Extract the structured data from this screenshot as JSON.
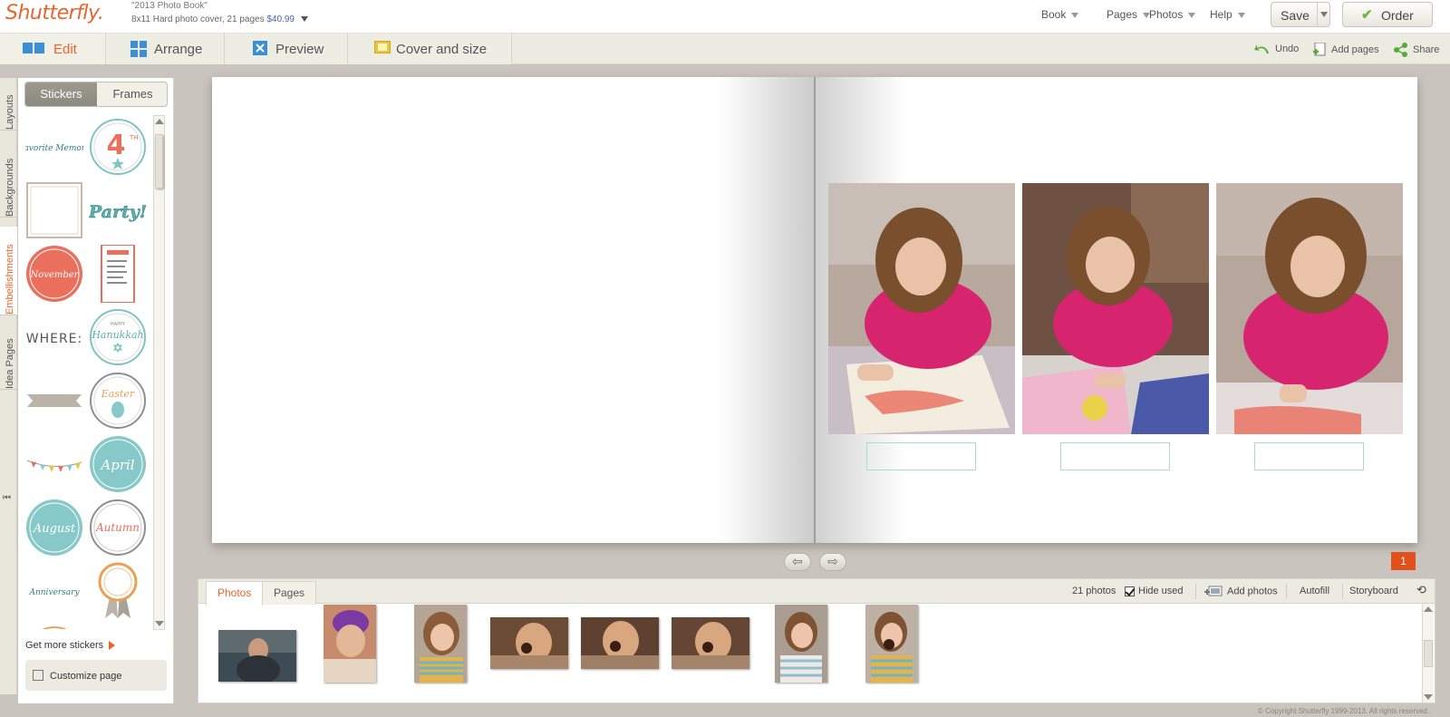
{
  "app": {
    "logo": "Shutterfly.",
    "project_title": "\"2013 Photo Book\"",
    "project_desc": "8x11 Hard photo cover, 21 pages",
    "price": "$40.99"
  },
  "top_menu": {
    "book": "Book",
    "pages": "Pages",
    "photos": "Photos",
    "help": "Help",
    "save": "Save",
    "order": "Order"
  },
  "main_tabs": {
    "edit": "Edit",
    "arrange": "Arrange",
    "preview": "Preview",
    "cover": "Cover and size"
  },
  "toolbar_right": {
    "undo": "Undo",
    "add_pages": "Add pages",
    "share": "Share"
  },
  "side_tabs": {
    "layouts": "Layouts",
    "backgrounds": "Backgrounds",
    "embellishments": "Embellishments",
    "idea_pages": "Idea Pages"
  },
  "panel": {
    "stickers_tab": "Stickers",
    "frames_tab": "Frames",
    "get_more": "Get more stickers",
    "customize": "Customize page",
    "stickers": {
      "favorite": "Favorite Memory",
      "fourth_num": "4",
      "fourth_sup": "TH",
      "party": "Party!",
      "november": "November",
      "where": "WHERE:",
      "hanukkah_top": "HAPPY",
      "hanukkah": "Hanukkah",
      "easter": "Easter",
      "april": "April",
      "august": "August",
      "autumn": "Autumn",
      "anniversary": "Anniversary"
    }
  },
  "page": {
    "number": "1"
  },
  "tray": {
    "photos_tab": "Photos",
    "pages_tab": "Pages",
    "count": "21 photos",
    "hide_used": "Hide used",
    "add_photos": "Add photos",
    "autofill": "Autofill",
    "storyboard": "Storyboard"
  },
  "footer": {
    "copyright": "© Copyright Shutterfly 1999-2013. All rights reserved."
  },
  "colors": {
    "brand": "#e8652f",
    "coral": "#ea6f5d",
    "teal": "#86c9c8",
    "price": "#4a62b5"
  }
}
